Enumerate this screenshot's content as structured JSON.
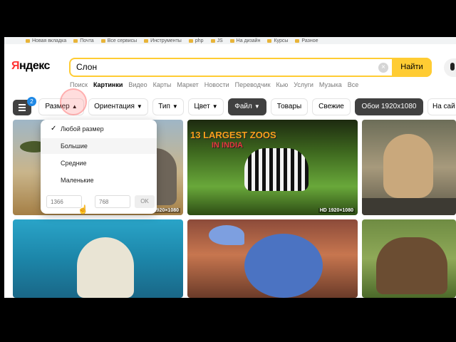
{
  "bookmarks": [
    {
      "label": "Новая вкладка"
    },
    {
      "label": "Почта"
    },
    {
      "label": "Все сервисы"
    },
    {
      "label": "Инструменты"
    },
    {
      "label": "php"
    },
    {
      "label": "JS"
    },
    {
      "label": "На дизайн"
    },
    {
      "label": "Курсы"
    },
    {
      "label": "Разное"
    }
  ],
  "header": {
    "logo_first": "Я",
    "logo_rest": "ндекс",
    "search_value": "Слон",
    "clear_symbol": "×",
    "find_label": "Найти"
  },
  "services": [
    "Поиск",
    "Картинки",
    "Видео",
    "Карты",
    "Маркет",
    "Новости",
    "Переводчик",
    "Кью",
    "Услуги",
    "Музыка",
    "Все"
  ],
  "services_active": "Картинки",
  "filters": {
    "settings_badge": "2",
    "size": "Размер",
    "orientation": "Ориентация",
    "type": "Тип",
    "color": "Цвет",
    "file": "Файл",
    "goods": "Товары",
    "fresh": "Свежие",
    "wallpaper": "Обои 1920x1080",
    "on_site": "На сай"
  },
  "size_dropdown": {
    "check": "✓",
    "options": [
      "Любой размер",
      "Большие",
      "Средние",
      "Маленькие"
    ],
    "selected": "Любой размер",
    "width_placeholder": "1366",
    "times": "×",
    "height_placeholder": "768",
    "ok_label": "OK"
  },
  "images": {
    "img1_res": "1920×1080",
    "img2_title": "13 LARGEST ZOOS",
    "img2_subtitle": "IN INDIA",
    "img2_res": "HD 1920×1080"
  },
  "colors": {
    "accent_yellow": "#ffcc33",
    "logo_red": "#ff3333",
    "dark_chip": "#404040",
    "badge_blue": "#1e88e5"
  }
}
